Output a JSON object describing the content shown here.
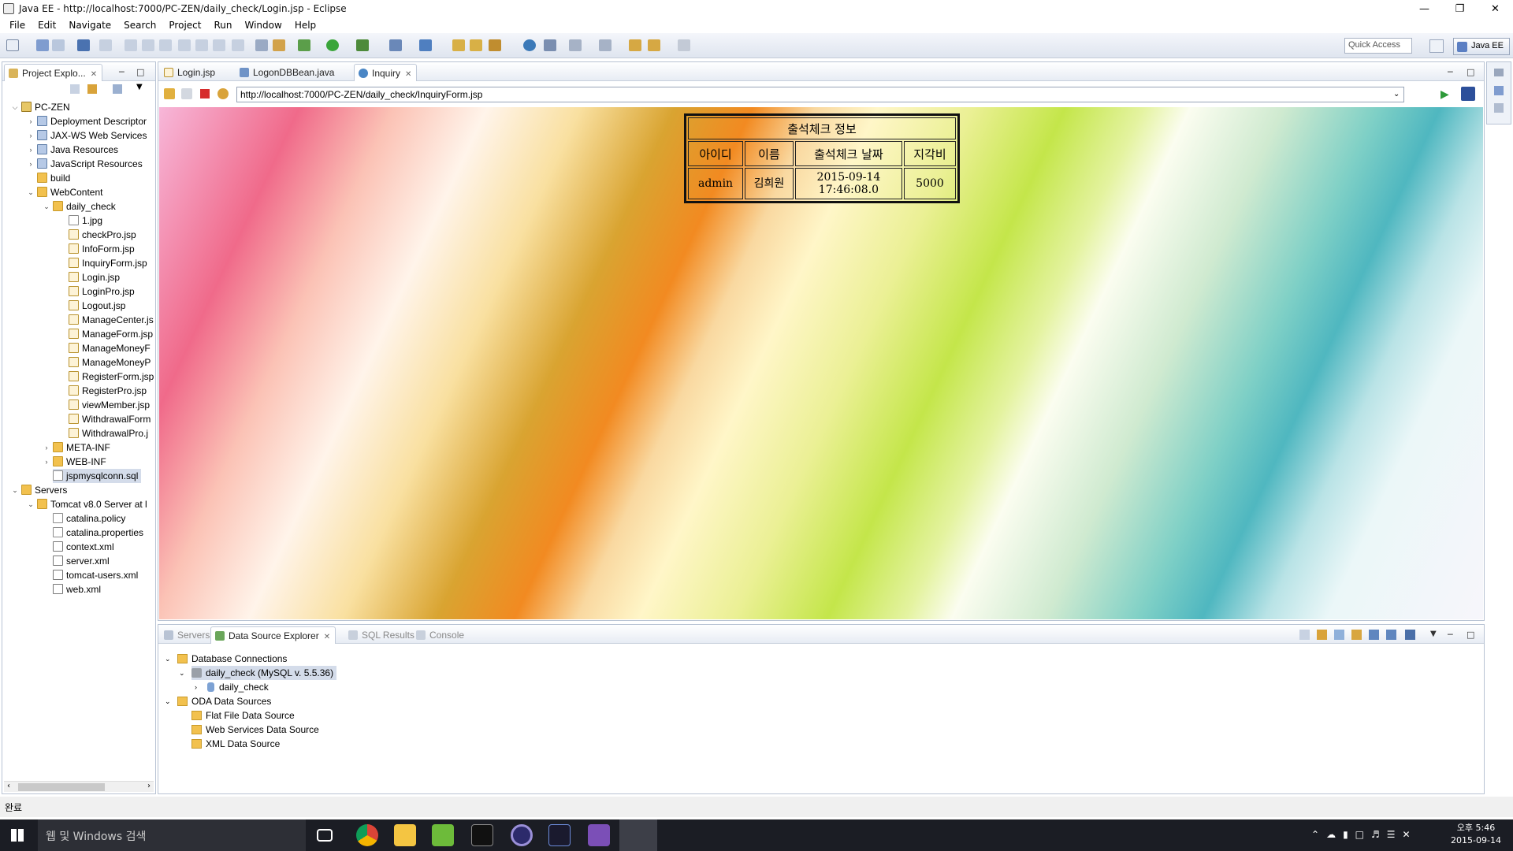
{
  "window": {
    "title": "Java EE - http://localhost:7000/PC-ZEN/daily_check/Login.jsp - Eclipse"
  },
  "menu": [
    "File",
    "Edit",
    "Navigate",
    "Search",
    "Project",
    "Run",
    "Window",
    "Help"
  ],
  "toolbar": {
    "quick_access": "Quick Access",
    "perspective": "Java EE"
  },
  "explorer": {
    "tab": "Project Explo...",
    "project": "PC-ZEN",
    "nodes": [
      "Deployment Descriptor",
      "JAX-WS Web Services",
      "Java Resources",
      "JavaScript Resources",
      "build",
      "WebContent",
      "daily_check"
    ],
    "files": [
      "1.jpg",
      "checkPro.jsp",
      "InfoForm.jsp",
      "InquiryForm.jsp",
      "Login.jsp",
      "LoginPro.jsp",
      "Logout.jsp",
      "ManageCenter.js",
      "ManageForm.jsp",
      "ManageMoneyF",
      "ManageMoneyP",
      "RegisterForm.jsp",
      "RegisterPro.jsp",
      "viewMember.jsp",
      "WithdrawalForm",
      "WithdrawalPro.j"
    ],
    "meta": "META-INF",
    "webinf": "WEB-INF",
    "sqlfile": "jspmysqlconn.sql",
    "servers": "Servers",
    "tomcat": "Tomcat v8.0 Server at l",
    "server_files": [
      "catalina.policy",
      "catalina.properties",
      "context.xml",
      "server.xml",
      "tomcat-users.xml",
      "web.xml"
    ]
  },
  "editor": {
    "tabs": [
      "Login.jsp",
      "LogonDBBean.java",
      "Inquiry"
    ],
    "url": "http://localhost:7000/PC-ZEN/daily_check/InquiryForm.jsp"
  },
  "inquiry_table": {
    "caption": "출석체크 정보",
    "headers": [
      "아이디",
      "이름",
      "출석체크 날짜",
      "지각비"
    ],
    "row": {
      "id": "admin",
      "name": "김희원",
      "date1": "2015-09-14",
      "date2": "17:46:08.0",
      "fee": "5000"
    }
  },
  "bottom": {
    "tabs": [
      "Servers",
      "Data Source Explorer",
      "SQL Results",
      "Console"
    ],
    "db_connections": "Database Connections",
    "connection": "daily_check (MySQL v. 5.5.36)",
    "schema": "daily_check",
    "oda": "ODA Data Sources",
    "oda_items": [
      "Flat File Data Source",
      "Web Services Data Source",
      "XML Data Source"
    ]
  },
  "status": {
    "text": "완료"
  },
  "taskbar": {
    "search": "웹 및 Windows 검색",
    "time": "오후 5:46",
    "date": "2015-09-14"
  },
  "colors": {
    "accent": "#3a6ea5",
    "selection": "#d4dcea"
  }
}
